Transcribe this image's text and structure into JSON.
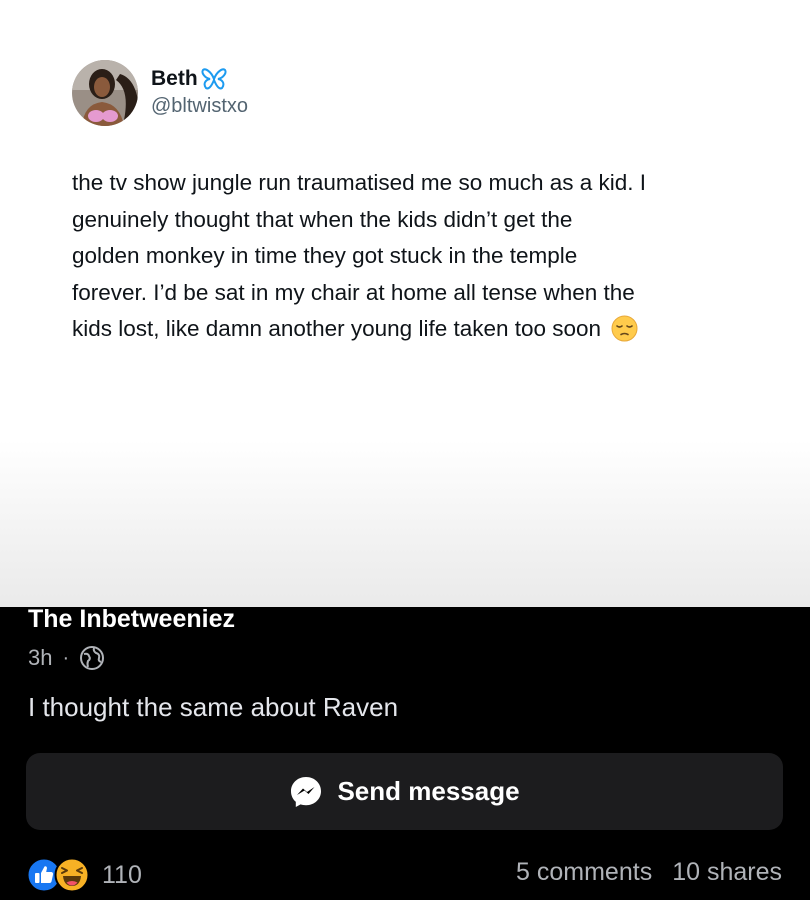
{
  "tweet": {
    "author_name": "Beth",
    "author_handle": "@bltwistxo",
    "text_lines": [
      "the tv show jungle run traumatised me so much as a kid. I",
      "genuinely thought that when the kids didn’t get the",
      "golden monkey in time they got stuck in the temple",
      "forever. I’d be sat in my chair at home all tense when the",
      "kids lost, like damn another young life taken too soon"
    ],
    "end_emoji": "pensive-face-emoji"
  },
  "post": {
    "page_name": "The Inbetweeniez",
    "time": "3h",
    "separator": "·",
    "audience_icon": "globe-icon",
    "caption": "I thought the same about Raven"
  },
  "actions": {
    "send_message_label": "Send message",
    "send_message_icon": "messenger-icon"
  },
  "engagement": {
    "reaction_icons": [
      "like-icon",
      "haha-icon"
    ],
    "reaction_count": "110",
    "comments": "5 comments",
    "shares": "10 shares"
  },
  "colors": {
    "background": "#000000",
    "card": "#ffffff",
    "button": "#1c1c1e",
    "like_blue": "#1877f2",
    "haha_yellow": "#f7b125",
    "butterfly_blue": "#1d9bf0"
  }
}
